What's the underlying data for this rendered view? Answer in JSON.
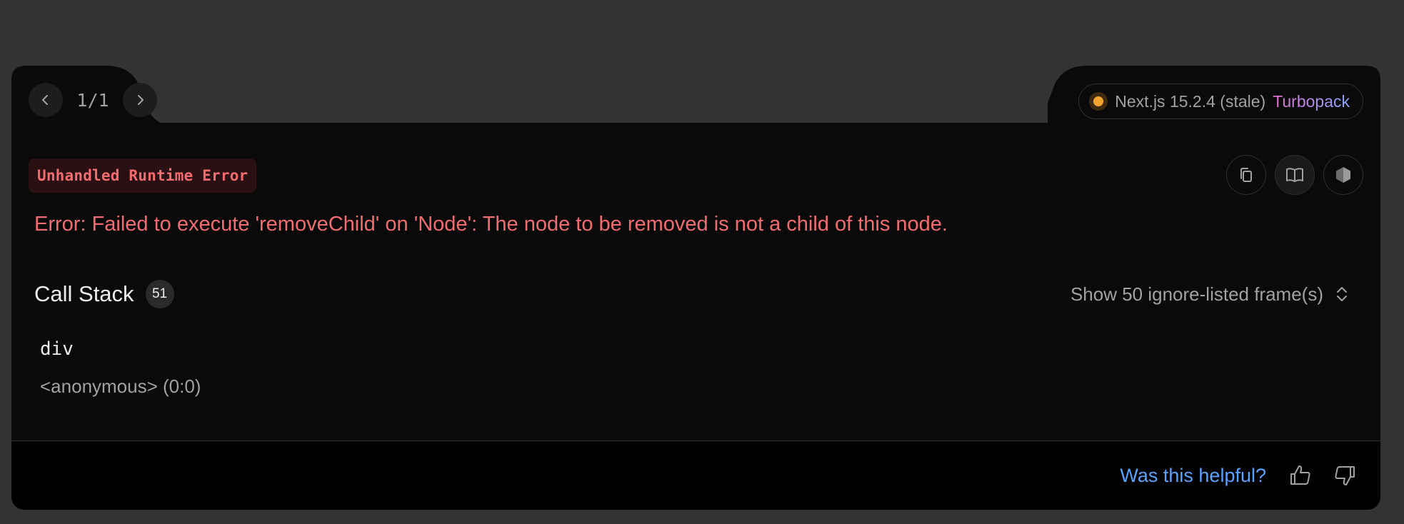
{
  "pager": {
    "count": "1/1"
  },
  "version": {
    "label": "Next.js 15.2.4 (stale)",
    "bundler": "Turbopack"
  },
  "error": {
    "type_label": "Unhandled Runtime Error",
    "message": "Error: Failed to execute 'removeChild' on 'Node': The node to be removed is not a child of this node."
  },
  "call_stack": {
    "title": "Call Stack",
    "count": "51",
    "ignore_toggle": "Show 50 ignore-listed frame(s)",
    "frames": [
      {
        "name": "div",
        "location": "<anonymous> (0:0)"
      }
    ]
  },
  "footer": {
    "helpful": "Was this helpful?"
  },
  "colors": {
    "background": "#333333",
    "card": "#0a0a0a",
    "error": "#f16c6f",
    "link": "#5aa2ff",
    "status_dot": "#f5a431"
  },
  "icons": [
    "chevron-left-icon",
    "chevron-right-icon",
    "status-dot-icon",
    "copy-icon",
    "docs-book-icon",
    "nodejs-icon",
    "chevron-up-down-icon",
    "thumbs-up-icon",
    "thumbs-down-icon"
  ]
}
